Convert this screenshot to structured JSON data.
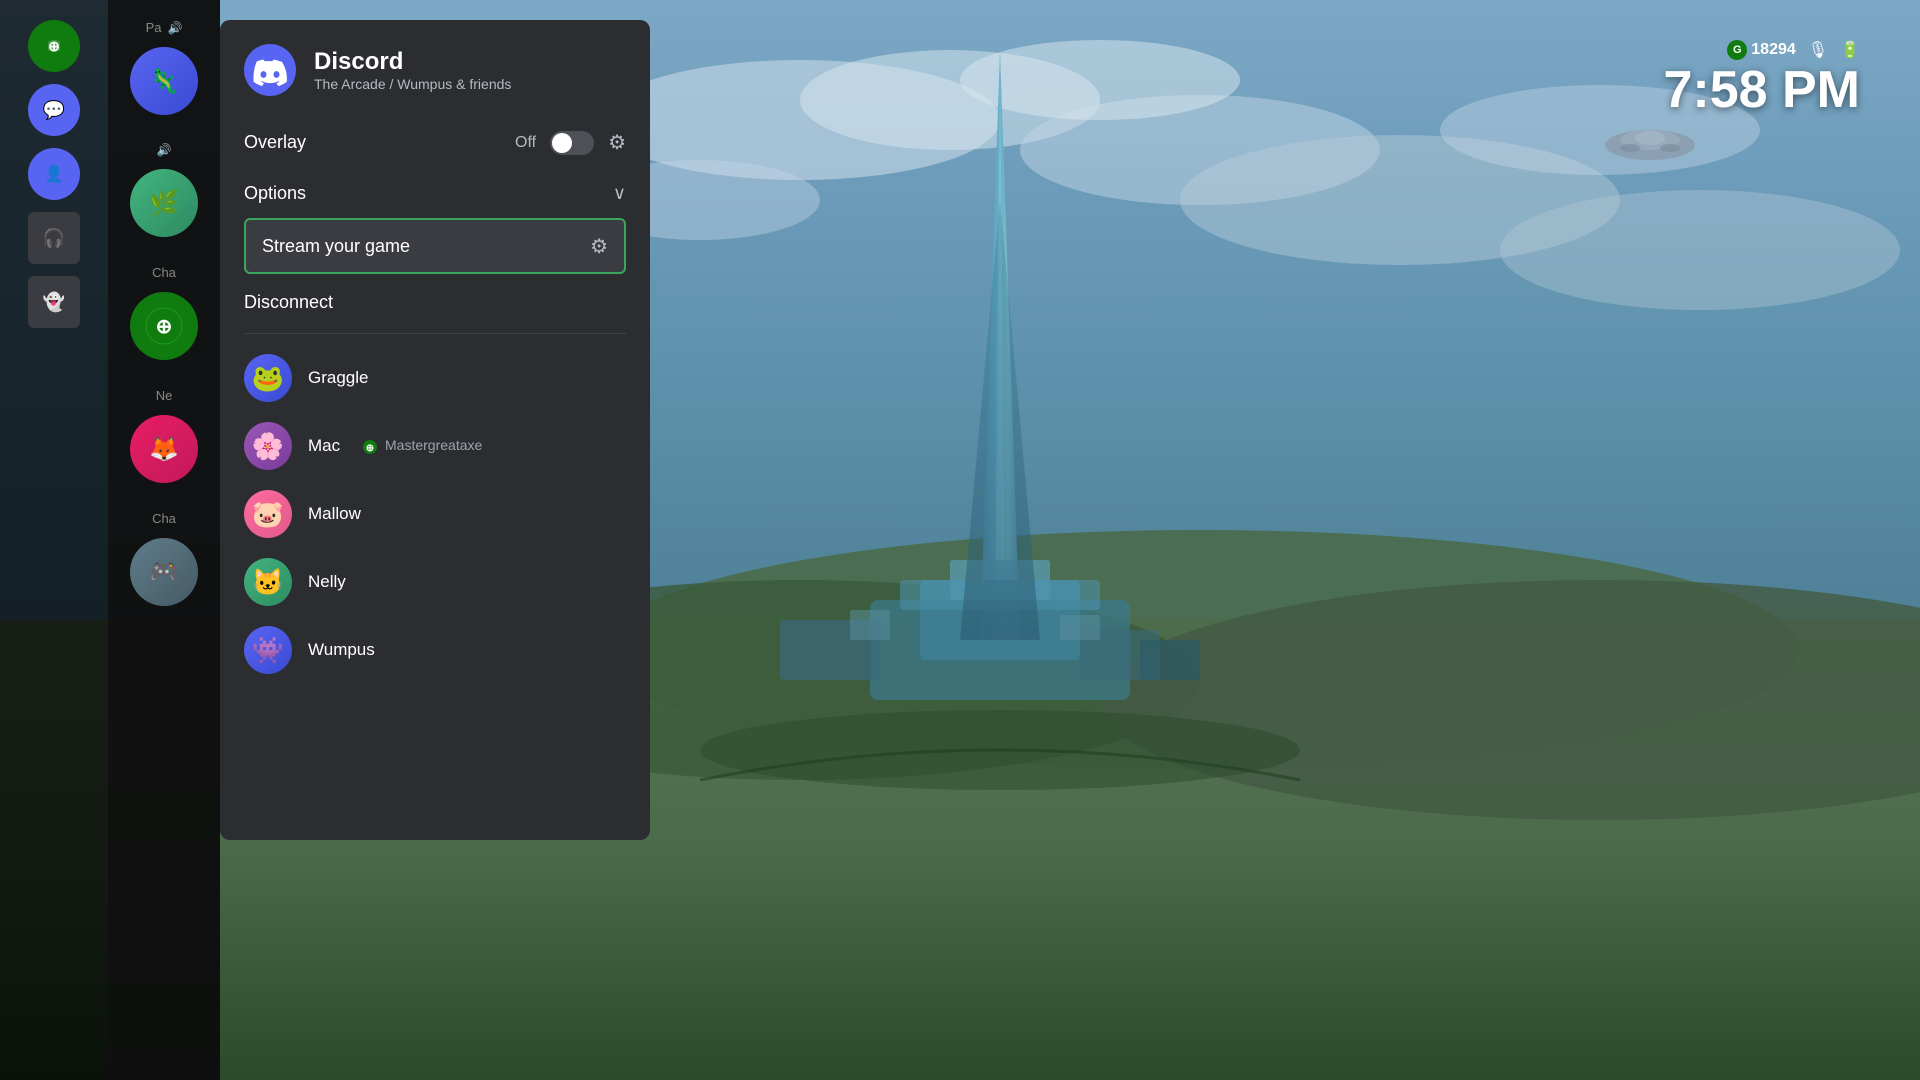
{
  "background": {
    "description": "Halo game background with futuristic tower"
  },
  "hud": {
    "g_score_value": "18294",
    "time": "7:58 PM",
    "mic_icon": "🎤",
    "battery_icon": "🔋"
  },
  "discord_panel": {
    "logo_alt": "Discord logo",
    "title": "Discord",
    "subtitle": "The Arcade / Wumpus & friends",
    "overlay_label": "Overlay",
    "overlay_status": "Off",
    "options_label": "Options",
    "stream_button_label": "Stream your game",
    "disconnect_label": "Disconnect",
    "friends": [
      {
        "name": "Graggle",
        "avatar_color": "#5865f2",
        "avatar_emoji": "🐸",
        "has_xbox": false
      },
      {
        "name": "Mac",
        "gamertag": "Mastergreataxe",
        "avatar_color": "#9b59b6",
        "avatar_emoji": "🌸",
        "has_xbox": true
      },
      {
        "name": "Mallow",
        "avatar_color": "#ff6b9d",
        "avatar_emoji": "🐷",
        "has_xbox": false
      },
      {
        "name": "Nelly",
        "avatar_color": "#43b581",
        "avatar_emoji": "🐱",
        "has_xbox": false
      },
      {
        "name": "Wumpus",
        "avatar_color": "#5865f2",
        "avatar_emoji": "👾",
        "has_xbox": false
      }
    ]
  },
  "sidebar": {
    "text_items": [
      "Pa",
      "Cha",
      "Ne",
      "Cha"
    ]
  }
}
